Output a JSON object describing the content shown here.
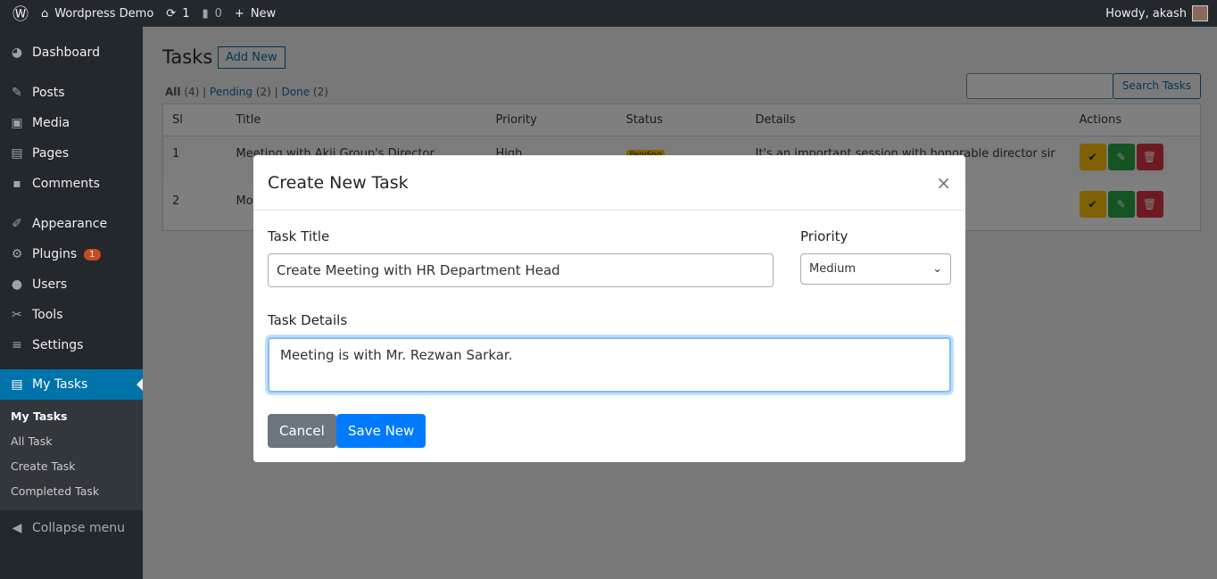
{
  "adminbar": {
    "site": "Wordpress Demo",
    "updates": "1",
    "comments": "0",
    "new": "New",
    "howdy": "Howdy, akash"
  },
  "sidebar": {
    "items": [
      {
        "label": "Dashboard",
        "icon": "◕"
      },
      {
        "label": "Posts",
        "icon": "✎"
      },
      {
        "label": "Media",
        "icon": "▣"
      },
      {
        "label": "Pages",
        "icon": "▤"
      },
      {
        "label": "Comments",
        "icon": "▪"
      },
      {
        "label": "Appearance",
        "icon": "✐"
      },
      {
        "label": "Plugins",
        "icon": "⚙",
        "badge": "1"
      },
      {
        "label": "Users",
        "icon": "●"
      },
      {
        "label": "Tools",
        "icon": "✂"
      },
      {
        "label": "Settings",
        "icon": "≡"
      },
      {
        "label": "My Tasks",
        "icon": "▤"
      }
    ],
    "submenu": [
      "My Tasks",
      "All Task",
      "Create Task",
      "Completed Task"
    ],
    "collapse": "Collapse menu"
  },
  "page": {
    "title": "Tasks",
    "add_new": "Add New",
    "filters": {
      "all": "All",
      "all_count": "(4)",
      "pending": "Pending",
      "pending_count": "(2)",
      "done": "Done",
      "done_count": "(2)"
    },
    "search_button": "Search Tasks"
  },
  "table": {
    "headers": [
      "Sl",
      "Title",
      "Priority",
      "Status",
      "Details",
      "Actions"
    ],
    "rows": [
      {
        "sl": "1",
        "title": "Meeting with Akij Group's Director",
        "priority": "High",
        "status": "Pending",
        "details": "It's an important session with honorable director sir at 3:0"
      },
      {
        "sl": "2",
        "title": "Mo"
      }
    ]
  },
  "modal": {
    "title": "Create New Task",
    "task_title_label": "Task Title",
    "task_title_value": "Create Meeting with HR Department Head",
    "priority_label": "Priority",
    "priority_value": "Medium",
    "details_label": "Task Details",
    "details_value": "Meeting is with Mr. Rezwan Sarkar.",
    "cancel": "Cancel",
    "save": "Save New"
  },
  "colors": {
    "accent": "#0073aa",
    "primary": "#007bff",
    "secondary": "#6c757d",
    "warning": "#ffc107",
    "success": "#28a745",
    "danger": "#dc3545"
  }
}
